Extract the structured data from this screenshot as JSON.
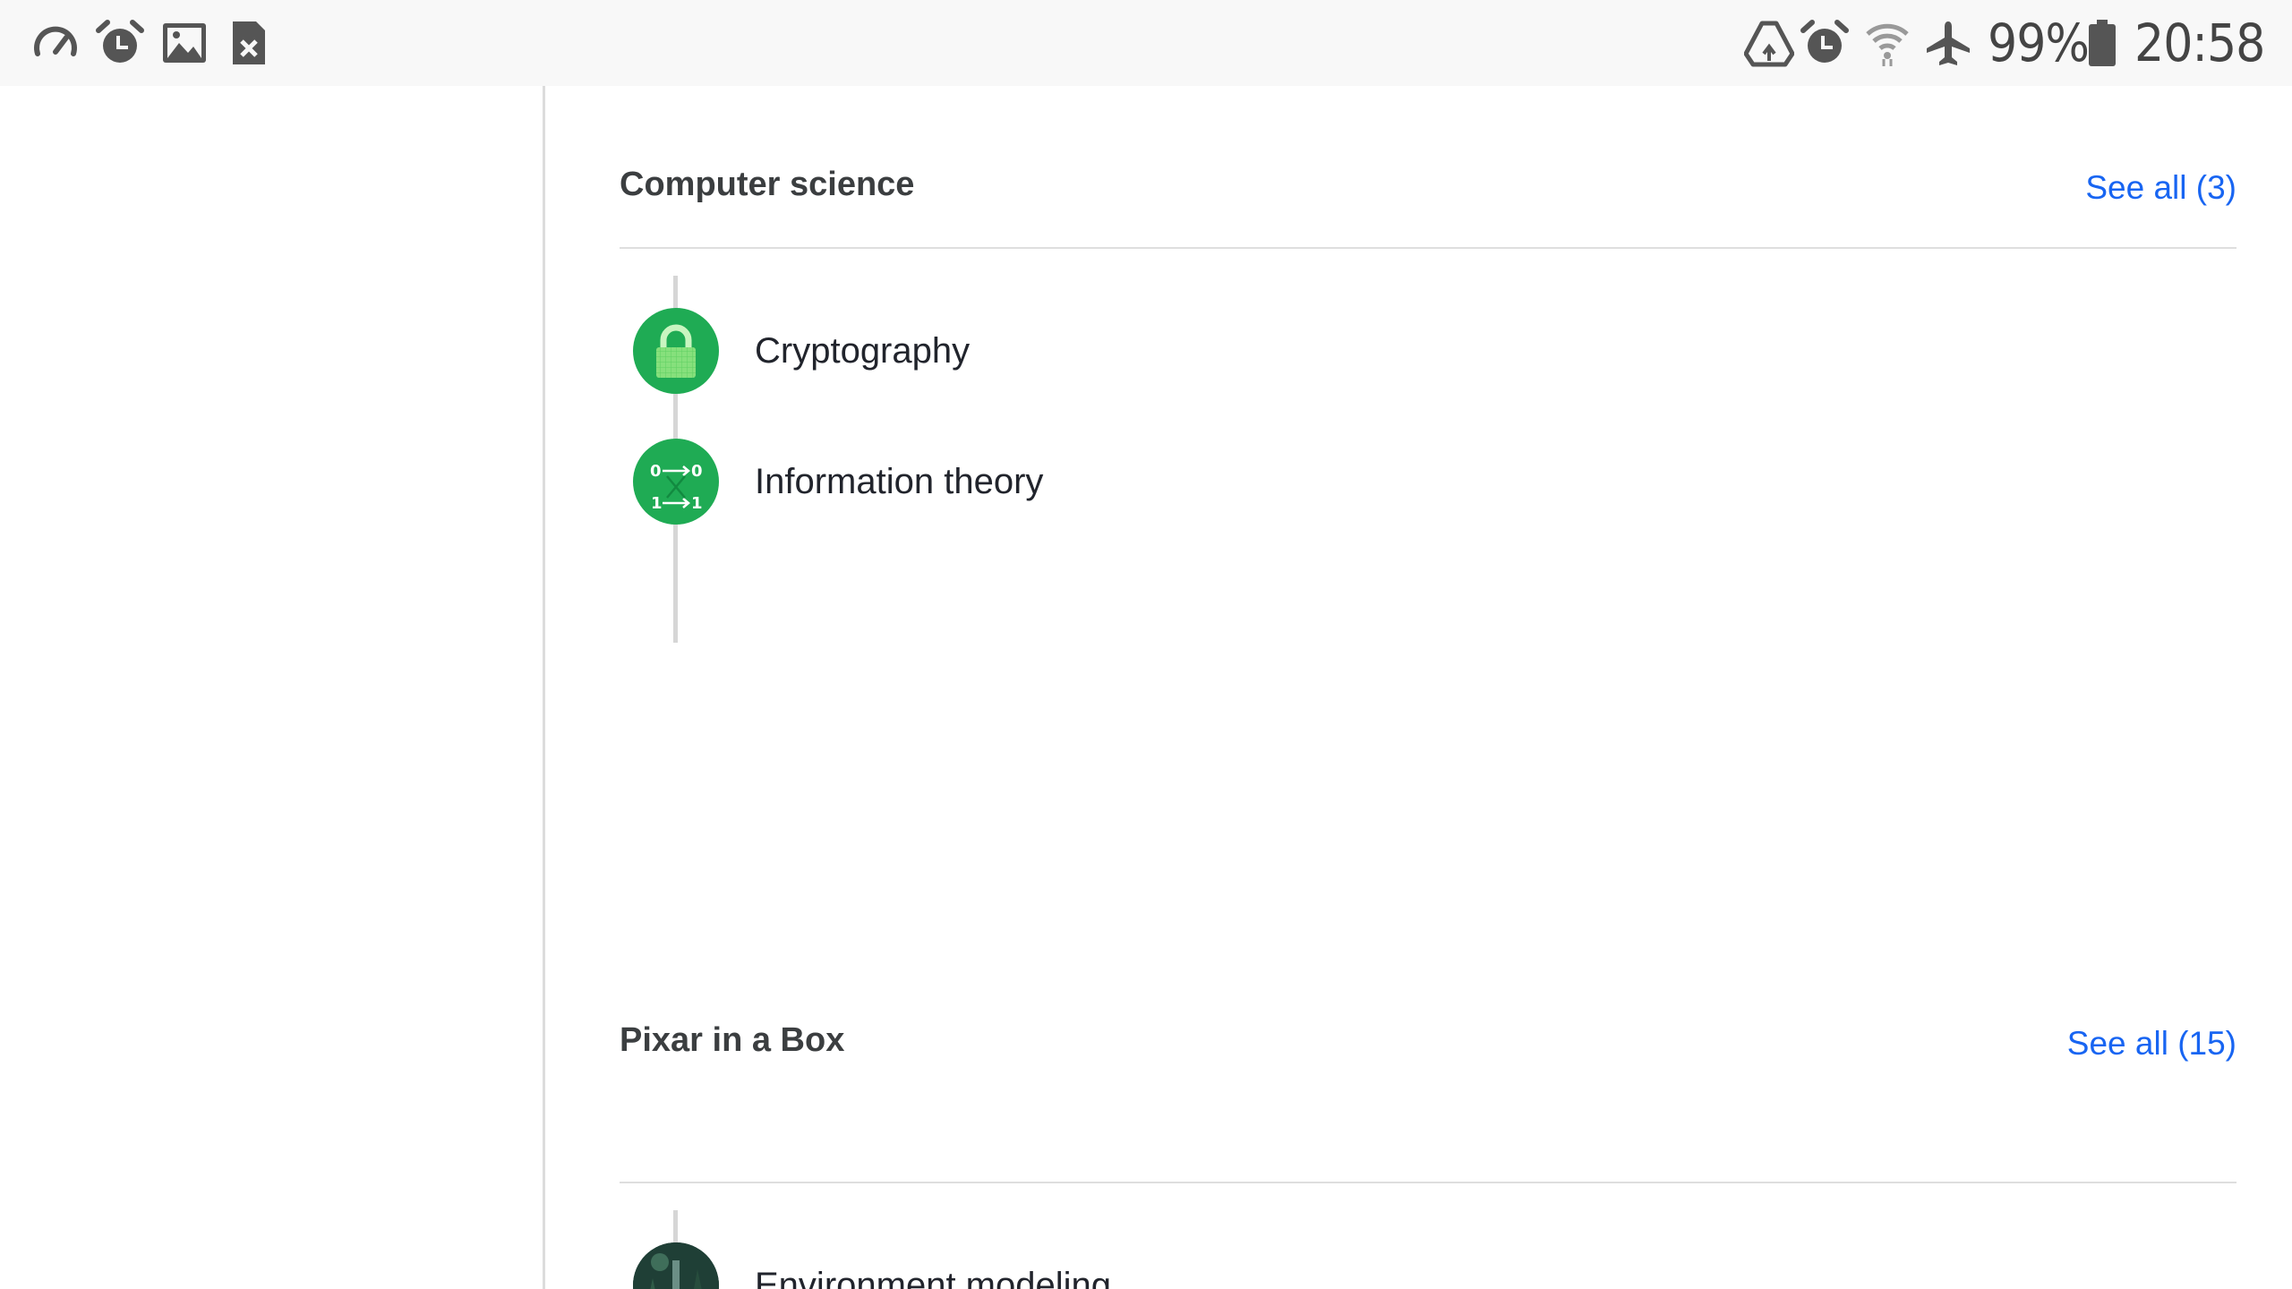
{
  "status_bar": {
    "left_icons": [
      "speedometer-icon",
      "alarm-clock-icon",
      "image-icon",
      "file-error-icon"
    ],
    "right_icons": [
      "drive-sync-icon",
      "alarm-clock-icon",
      "wifi-icon",
      "airplane-mode-icon",
      "battery-icon"
    ],
    "battery": "99%",
    "time": "20:58"
  },
  "sections": [
    {
      "title": "Computer science",
      "see_all": "See all (3)",
      "topics": [
        {
          "label": "Cryptography",
          "icon": "padlock-icon"
        },
        {
          "label": "Information theory",
          "icon": "binary-channel-icon"
        }
      ]
    },
    {
      "title": "Pixar in a Box",
      "see_all": "See all (15)",
      "topics": [
        {
          "label": "Environment modeling",
          "icon": "forest-scene-icon"
        }
      ]
    }
  ],
  "colors": {
    "accent_link": "#1865f2",
    "topic_green": "#1fab54",
    "divider": "#dedede"
  }
}
